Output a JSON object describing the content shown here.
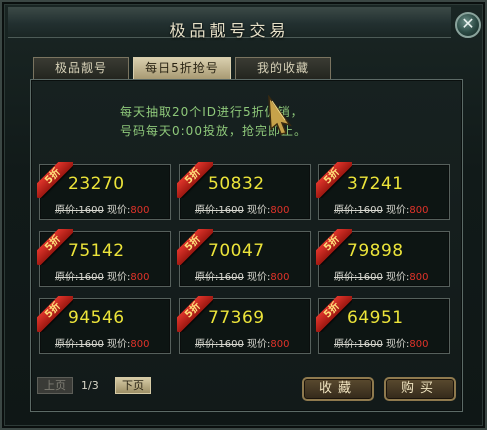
{
  "window": {
    "title": "极品靓号交易",
    "close_glyph": "✕"
  },
  "tabs": [
    {
      "label": "极品靓号",
      "active": false
    },
    {
      "label": "每日5折抢号",
      "active": true
    },
    {
      "label": "我的收藏",
      "active": false
    }
  ],
  "notice": {
    "line1": "每天抽取20个ID进行5折促销，",
    "line2": "号码每天0:00投放，抢完即止。"
  },
  "cards": [
    {
      "badge": "5折",
      "number": "23270",
      "orig_label": "原价:1600",
      "now_label": "现价:",
      "now_value": "800"
    },
    {
      "badge": "5折",
      "number": "50832",
      "orig_label": "原价:1600",
      "now_label": "现价:",
      "now_value": "800"
    },
    {
      "badge": "5折",
      "number": "37241",
      "orig_label": "原价:1600",
      "now_label": "现价:",
      "now_value": "800"
    },
    {
      "badge": "5折",
      "number": "75142",
      "orig_label": "原价:1600",
      "now_label": "现价:",
      "now_value": "800"
    },
    {
      "badge": "5折",
      "number": "70047",
      "orig_label": "原价:1600",
      "now_label": "现价:",
      "now_value": "800"
    },
    {
      "badge": "5折",
      "number": "79898",
      "orig_label": "原价:1600",
      "now_label": "现价:",
      "now_value": "800"
    },
    {
      "badge": "5折",
      "number": "94546",
      "orig_label": "原价:1600",
      "now_label": "现价:",
      "now_value": "800"
    },
    {
      "badge": "5折",
      "number": "77369",
      "orig_label": "原价:1600",
      "now_label": "现价:",
      "now_value": "800"
    },
    {
      "badge": "5折",
      "number": "64951",
      "orig_label": "原价:1600",
      "now_label": "现价:",
      "now_value": "800"
    }
  ],
  "pager": {
    "prev_label": "上页",
    "page_info": "1/3",
    "next_label": "下页"
  },
  "actions": {
    "favorite_label": "收藏",
    "buy_label": "购买"
  },
  "colors": {
    "number": "#ece43a",
    "sale_price": "#e0332a",
    "notice": "#8ec87a",
    "badge": "#e0352b"
  }
}
